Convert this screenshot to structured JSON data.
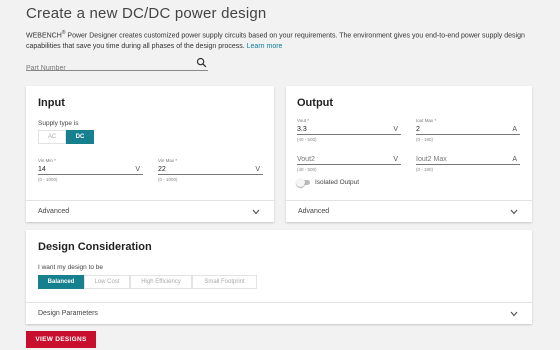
{
  "header": {
    "title": "Create a new DC/DC power design",
    "intro_brand": "WEBENCH",
    "intro_reg": "®",
    "intro_text": " Power Designer creates customized power supply circuits based on your requirements. The environment gives you end-to-end power supply design capabilities that save you time during all phases of the design process. ",
    "learn_more": "Learn more"
  },
  "search": {
    "placeholder": "Part Number",
    "value": ""
  },
  "input": {
    "title": "Input",
    "supply_type_label": "Supply type is",
    "supply_options": [
      "AC",
      "DC"
    ],
    "supply_selected": "DC",
    "vin_min": {
      "label": "Vin Min *",
      "value": "14",
      "unit": "V",
      "range": "(0 - 1000)"
    },
    "vin_max": {
      "label": "Vin Max *",
      "value": "22",
      "unit": "V",
      "range": "(0 - 1000)"
    },
    "advanced_label": "Advanced"
  },
  "output": {
    "title": "Output",
    "vout": {
      "label": "Vout *",
      "value": "3.3",
      "unit": "V",
      "range": "(40 - 500)"
    },
    "iout_max": {
      "label": "Iout Max *",
      "value": "2",
      "unit": "A",
      "range": "(0 - 180)"
    },
    "vout2": {
      "label": "",
      "value": "Vout2",
      "unit": "V",
      "range": "(40 - 500)"
    },
    "iout2_max": {
      "label": "",
      "value": "Iout2 Max",
      "unit": "A",
      "range": "(0 - 180)"
    },
    "isolated_label": "Isolated Output",
    "isolated_on": false,
    "advanced_label": "Advanced"
  },
  "design": {
    "title": "Design Consideration",
    "want_label": "I want my design to be",
    "options": [
      "Balanced",
      "Low Cost",
      "High Efficiency",
      "Small Footprint"
    ],
    "selected": "Balanced",
    "parameters_label": "Design Parameters"
  },
  "actions": {
    "view_designs": "VIEW DESIGNS"
  },
  "colors": {
    "accent": "#17808f",
    "primary_button": "#c8102e",
    "link": "#0e7c9c"
  },
  "icons": {
    "search": "search-icon",
    "chevron": "chevron-down-icon"
  }
}
